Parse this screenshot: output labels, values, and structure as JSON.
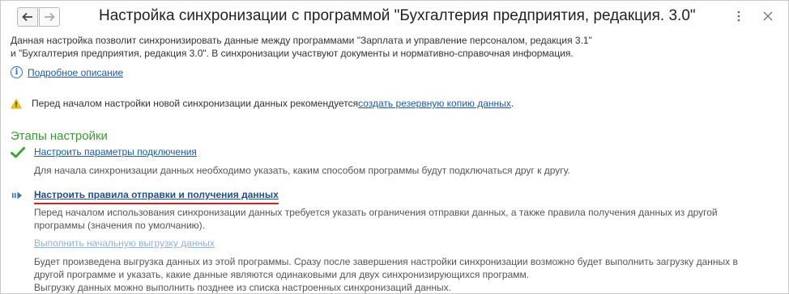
{
  "window": {
    "title": "Настройка синхронизации с программой \"Бухгалтерия предприятия, редакция. 3.0\""
  },
  "description": {
    "line1": "Данная настройка позволит синхронизировать данные между программами \"Зарплата и управление персоналом, редакция 3.1\"",
    "line2": "и \"Бухгалтерия предприятия, редакция 3.0\". В синхронизации участвуют документы и нормативно-справочная информация."
  },
  "details_link": "Подробное описание",
  "warning": {
    "text": "Перед началом настройки новой синхронизации данных рекомендуется ",
    "link": "создать резервную копию данных",
    "suffix": "."
  },
  "steps_title": "Этапы настройки",
  "steps": [
    {
      "label": "Настроить параметры подключения",
      "status": "done",
      "desc": [
        "Для начала синхронизации данных необходимо указать, каким способом программы будут подключаться друг к другу."
      ]
    },
    {
      "label": "Настроить правила отправки и получения данных",
      "status": "current",
      "desc": [
        "Перед началом использования синхронизации данных требуется указать ограничения отправки данных, а также правила получения данных из другой",
        "программы (значения по умолчанию)."
      ]
    },
    {
      "label": "Выполнить начальную выгрузку данных",
      "status": "pending",
      "desc": [
        "Будет произведена выгрузка данных из этой программы. Сразу после завершения настройки синхронизации возможно будет выполнить загрузку данных в",
        "другой программе и указать, какие данные являются одинаковыми для двух синхронизирующихся программ.",
        "Выгрузку данных можно выполнить позднее из списка настроенных синхронизаций данных."
      ]
    }
  ],
  "colors": {
    "section_title": "#3a9b35",
    "link": "#1d5aa6",
    "current_underline": "#d61f1f",
    "check": "#3aa636",
    "warning": "#f2c200"
  },
  "icons": {
    "back": "arrow-left-icon",
    "forward": "arrow-right-icon",
    "menu": "more-vertical-icon",
    "close": "close-icon",
    "info": "info-icon",
    "warning": "warning-icon",
    "done": "checkmark-icon",
    "current": "current-step-arrow-icon"
  }
}
